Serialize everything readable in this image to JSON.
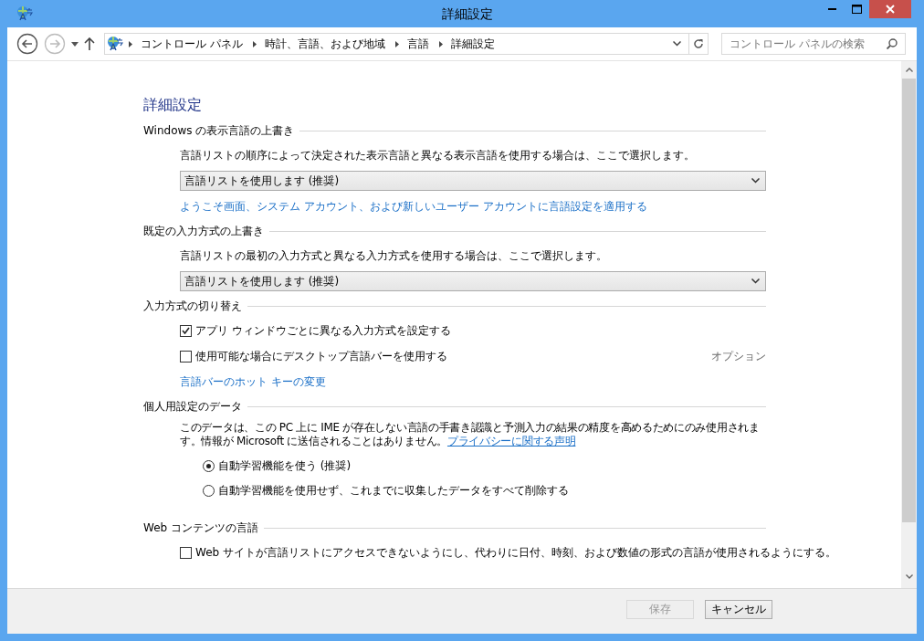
{
  "window": {
    "title": "詳細設定"
  },
  "nav": {
    "breadcrumb": [
      "コントロール パネル",
      "時計、言語、および地域",
      "言語",
      "詳細設定"
    ],
    "search": {
      "placeholder": "コントロール パネルの検索"
    }
  },
  "page_title": "詳細設定",
  "sections": [
    {
      "heading": "Windows の表示言語の上書き",
      "items": [
        {
          "kind": "text",
          "text": "言語リストの順序によって決定された表示言語と異なる表示言語を使用する場合は、ここで選択します。"
        },
        {
          "kind": "dropdown",
          "value": "言語リストを使用します (推奨)"
        },
        {
          "kind": "link",
          "text": "ようこそ画面、システム アカウント、および新しいユーザー アカウントに言語設定を適用する"
        }
      ]
    },
    {
      "heading": "既定の入力方式の上書き",
      "items": [
        {
          "kind": "text",
          "text": "言語リストの最初の入力方式と異なる入力方式を使用する場合は、ここで選択します。"
        },
        {
          "kind": "dropdown",
          "value": "言語リストを使用します (推奨)"
        }
      ]
    },
    {
      "heading": "入力方式の切り替え",
      "items": [
        {
          "kind": "checkbox",
          "label": "アプリ ウィンドウごとに異なる入力方式を設定する",
          "checked": true
        },
        {
          "kind": "checkbox",
          "label": "使用可能な場合にデスクトップ言語バーを使用する",
          "checked": false,
          "aside": "オプション"
        },
        {
          "kind": "link",
          "text": "言語バーのホット キーの変更"
        }
      ]
    },
    {
      "heading": "個人用設定のデータ",
      "items": [
        {
          "kind": "paragraph",
          "text": "このデータは、この PC 上に IME が存在しない言語の手書き認識と予測入力の結果の精度を高めるためにのみ使用されます。情報が Microsoft に送信されることはありません。",
          "link": "プライバシーに関する声明"
        },
        {
          "kind": "radio",
          "label": "自動学習機能を使う (推奨)",
          "selected": true
        },
        {
          "kind": "radio",
          "label": "自動学習機能を使用せず、これまでに収集したデータをすべて削除する",
          "selected": false
        }
      ]
    },
    {
      "heading": "Web コンテンツの言語",
      "items": [
        {
          "kind": "checkbox",
          "label": "Web サイトが言語リストにアクセスできないようにし、代わりに日付、時刻、および数値の形式の言語が使用されるようにする。",
          "checked": false
        }
      ]
    }
  ],
  "buttons": [
    {
      "label": "保存",
      "disabled": true
    },
    {
      "label": "キャンセル",
      "disabled": false
    }
  ]
}
